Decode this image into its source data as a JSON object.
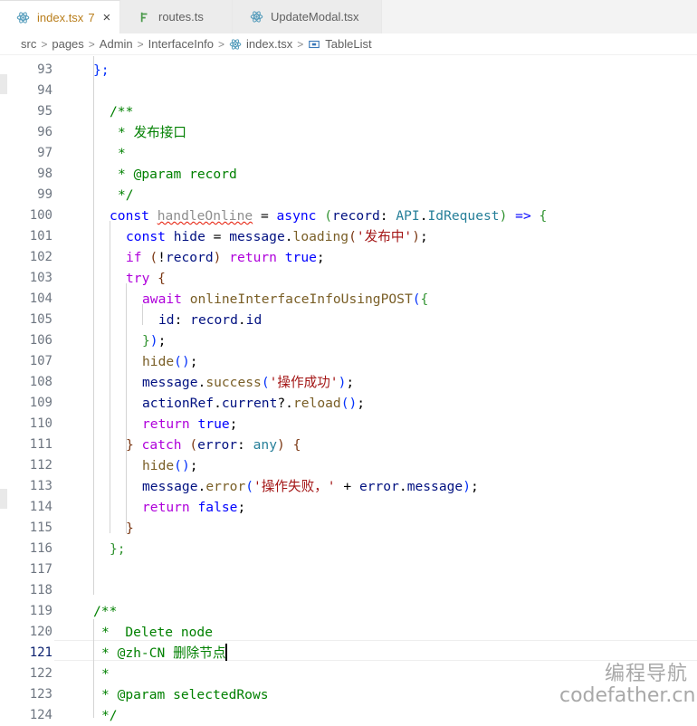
{
  "tabs": [
    {
      "icon": "react-icon",
      "name": "index.tsx",
      "count": "7",
      "close": "×",
      "active": true
    },
    {
      "icon": "route-icon",
      "name": "routes.ts",
      "active": false
    },
    {
      "icon": "react-icon",
      "name": "UpdateModal.tsx",
      "active": false
    }
  ],
  "breadcrumb": [
    "src",
    "pages",
    "Admin",
    "InterfaceInfo",
    "index.tsx",
    "TableList"
  ],
  "lines": [
    "93",
    "94",
    "95",
    "96",
    "97",
    "98",
    "99",
    "100",
    "101",
    "102",
    "103",
    "104",
    "105",
    "106",
    "107",
    "108",
    "109",
    "110",
    "111",
    "112",
    "113",
    "114",
    "115",
    "116",
    "117",
    "118",
    "119",
    "120",
    "121",
    "122",
    "123",
    "124"
  ],
  "current_line": "121",
  "code": {
    "l93": [
      "};"
    ],
    "l95": [
      "/**"
    ],
    "l96": [
      "* 发布接口"
    ],
    "l97": [
      "*"
    ],
    "l98": [
      "* @param ",
      "record"
    ],
    "l99": [
      "*/"
    ],
    "l100": [
      "const ",
      "handleOnline",
      " = ",
      "async",
      " ",
      "(",
      "record",
      ": ",
      "API",
      ".",
      "IdRequest",
      ")",
      " => ",
      "{"
    ],
    "l101": [
      "const ",
      "hide",
      " = ",
      "message",
      ".",
      "loading",
      "(",
      "'发布中'",
      ")",
      ";"
    ],
    "l102": [
      "if ",
      "(",
      "!",
      "record",
      ")",
      " return ",
      "true",
      ";"
    ],
    "l103": [
      "try ",
      "{"
    ],
    "l104": [
      "await ",
      "onlineInterfaceInfoUsingPOST",
      "(",
      "{"
    ],
    "l105": [
      "id",
      ": ",
      "record",
      ".",
      "id"
    ],
    "l106": [
      "}",
      ")",
      ";"
    ],
    "l107": [
      "hide",
      "()",
      ";"
    ],
    "l108": [
      "message",
      ".",
      "success",
      "(",
      "'操作成功'",
      ")",
      ";"
    ],
    "l109": [
      "actionRef",
      ".",
      "current",
      "?.",
      "reload",
      "()",
      ";"
    ],
    "l110": [
      "return ",
      "true",
      ";"
    ],
    "l111": [
      "}",
      " catch ",
      "(",
      "error",
      ": ",
      "any",
      ")",
      " ",
      "{"
    ],
    "l112": [
      "hide",
      "()",
      ";"
    ],
    "l113": [
      "message",
      ".",
      "error",
      "(",
      "'操作失败，'",
      " + ",
      "error",
      ".",
      "message",
      ")",
      ";"
    ],
    "l114": [
      "return ",
      "false",
      ";"
    ],
    "l115": [
      "}"
    ],
    "l116": [
      "};"
    ],
    "l119": [
      "/**"
    ],
    "l120": [
      "*  Delete node"
    ],
    "l121": [
      "* @zh-CN 删除节点"
    ],
    "l122": [
      "*"
    ],
    "l123": [
      "* @param ",
      "selectedRows"
    ],
    "l124": [
      "*/"
    ]
  },
  "watermark": {
    "line1": "编程导航",
    "line2": "codefather.cn"
  },
  "colors": {
    "keyword": "#0000ff",
    "control": "#af00db",
    "comment": "#008000",
    "string": "#a31515",
    "function": "#795e26",
    "variable": "#001080",
    "type": "#267f99"
  }
}
